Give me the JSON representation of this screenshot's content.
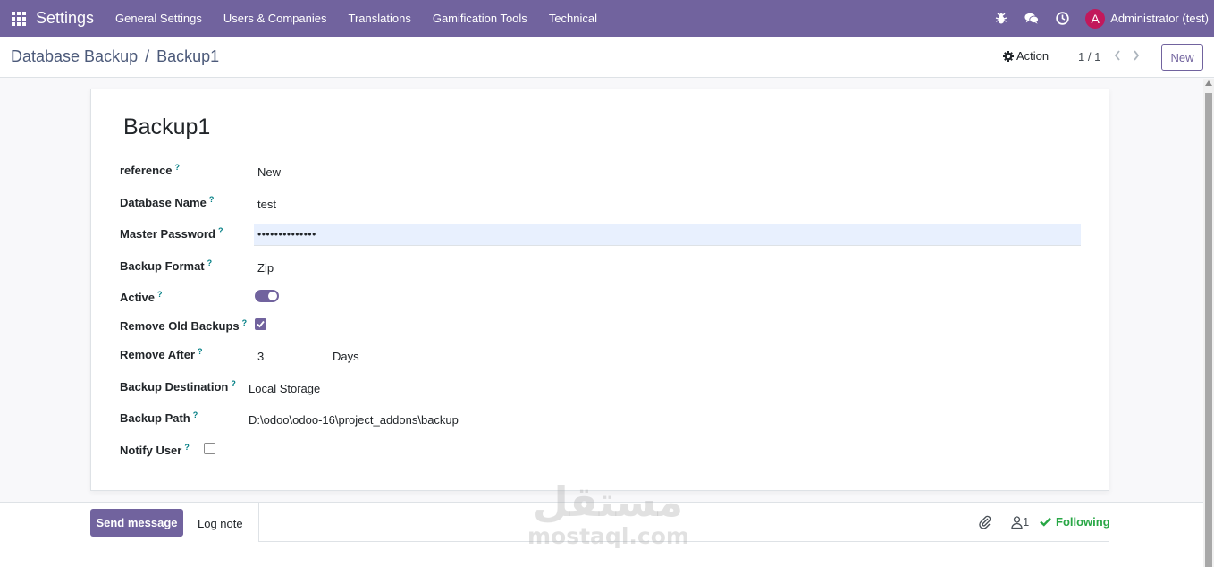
{
  "navbar": {
    "brand": "Settings",
    "menu": [
      "General Settings",
      "Users & Companies",
      "Translations",
      "Gamification Tools",
      "Technical"
    ],
    "user": {
      "initial": "A",
      "name": "Administrator (test)",
      "avatar_color": "#c2185b"
    },
    "tray_icons": [
      "bug-icon",
      "chat-icon",
      "clock-icon"
    ],
    "color": "#71639e"
  },
  "control": {
    "breadcrumb_parent": "Database Backup",
    "breadcrumb_separator": "/",
    "breadcrumb_current": "Backup1",
    "action_label": "Action",
    "pager": "1 / 1",
    "new_label": "New"
  },
  "form": {
    "title": "Backup1",
    "fields": {
      "reference": {
        "label": "reference",
        "value": "New"
      },
      "database_name": {
        "label": "Database Name",
        "value": "test"
      },
      "master_password": {
        "label": "Master Password",
        "value": "••••••••••••••"
      },
      "backup_format": {
        "label": "Backup Format",
        "value": "Zip"
      },
      "active": {
        "label": "Active",
        "value": true
      },
      "remove_old_backups": {
        "label": "Remove Old Backups",
        "value": true
      },
      "remove_after": {
        "label": "Remove After",
        "value": "3",
        "unit": "Days"
      },
      "backup_destination": {
        "label": "Backup Destination",
        "value": "Local Storage"
      },
      "backup_path": {
        "label": "Backup Path",
        "value": "D:\\odoo\\odoo-16\\project_addons\\backup"
      },
      "notify_user": {
        "label": "Notify User",
        "value": false
      }
    },
    "help_marker": "?"
  },
  "chatter": {
    "send_label": "Send message",
    "log_label": "Log note",
    "followers_count": "1",
    "following_label": "Following"
  },
  "watermark": {
    "arabic": "مستقل",
    "latin": "mostaql.com"
  }
}
